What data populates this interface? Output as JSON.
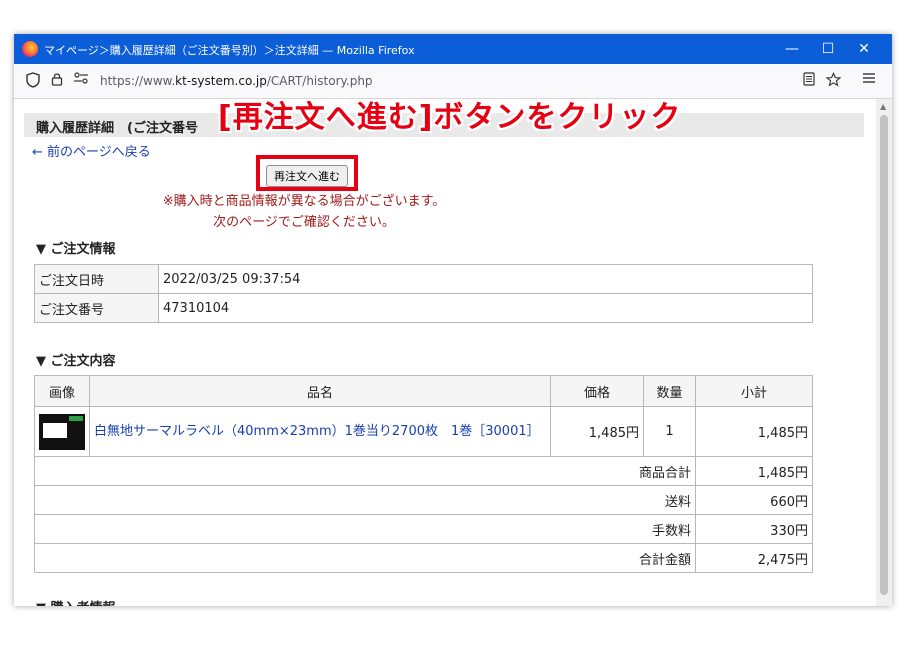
{
  "window": {
    "title": "マイページ＞購入履歴詳細（ご注文番号別）＞注文詳細 — Mozilla Firefox",
    "controls": [
      "—",
      "☐",
      "✕"
    ]
  },
  "browser": {
    "url_prefix": "https://www.",
    "url_domain": "kt-system.co.jp",
    "url_path": "/CART/history.php",
    "icons": [
      "shield-icon",
      "lock-icon",
      "permissions-icon",
      "reader-view-icon",
      "bookmark-star-icon",
      "menu-icon"
    ]
  },
  "page": {
    "header": "購入履歴詳細　(ご注文番号",
    "back_link": "← 前のページへ戻る",
    "reorder_button": "再注文へ進む",
    "notice_line1": "※購入時と商品情報が異なる場合がございます。",
    "notice_line2": "次のページでご確認ください。",
    "order_info_title": "▼ ご注文情報",
    "order_info": [
      {
        "label": "ご注文日時",
        "value": "2022/03/25 09:37:54"
      },
      {
        "label": "ご注文番号",
        "value": "47310104"
      }
    ],
    "order_contents_title": "▼ ご注文内容",
    "columns": [
      "画像",
      "品名",
      "価格",
      "数量",
      "小計"
    ],
    "items": [
      {
        "name": "白無地サーマルラベル（40mm×23mm）1巻当り2700枚　1巻［30001］",
        "price": "1,485円",
        "qty": "1",
        "subtotal": "1,485円"
      }
    ],
    "summary": [
      {
        "label": "商品合計",
        "value": "1,485円"
      },
      {
        "label": "送料",
        "value": "660円"
      },
      {
        "label": "手数料",
        "value": "330円"
      },
      {
        "label": "合計金額",
        "value": "2,475円"
      }
    ],
    "buyer_title": "▼ 購入者情報"
  },
  "overlay": {
    "caption": "[再注文へ進む]ボタンをクリック",
    "highlight_color": "#e60012"
  }
}
